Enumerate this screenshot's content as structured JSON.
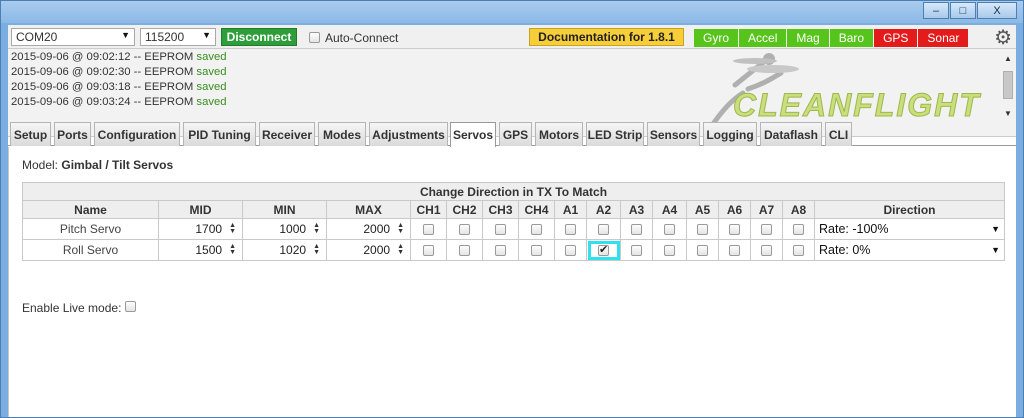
{
  "window": {
    "buttons": [
      "–",
      "□",
      "X"
    ]
  },
  "toolbar": {
    "port": "COM20",
    "baud": "115200",
    "disconnect_label": "Disconnect",
    "auto_connect_label": "Auto-Connect",
    "auto_connect_checked": false,
    "documentation_label": "Documentation for 1.8.1",
    "sensors": [
      {
        "label": "Gyro",
        "state": "on"
      },
      {
        "label": "Accel",
        "state": "on"
      },
      {
        "label": "Mag",
        "state": "on"
      },
      {
        "label": "Baro",
        "state": "on"
      },
      {
        "label": "GPS",
        "state": "off"
      },
      {
        "label": "Sonar",
        "state": "off"
      }
    ],
    "colors": {
      "sensor_on": "#57c41b",
      "sensor_off": "#e31b1b",
      "disconnect": "#2e9e3a",
      "documentation": "#f7ce39"
    },
    "settings_icon": "gear-icon"
  },
  "log": {
    "lines": [
      {
        "time": "2015-09-06 @ 09:02:12 -- EEPROM",
        "status": "saved"
      },
      {
        "time": "2015-09-06 @ 09:02:30 -- EEPROM",
        "status": "saved"
      },
      {
        "time": "2015-09-06 @ 09:03:18 -- EEPROM",
        "status": "saved"
      },
      {
        "time": "2015-09-06 @ 09:03:24 -- EEPROM",
        "status": "saved"
      }
    ],
    "logo_text": "CLEANFLIGHT"
  },
  "tabs": [
    "Setup",
    "Ports",
    "Configuration",
    "PID Tuning",
    "Receiver",
    "Modes",
    "Adjustments",
    "Servos",
    "GPS",
    "Motors",
    "LED Strip",
    "Sensors",
    "Logging",
    "Dataflash",
    "CLI"
  ],
  "active_tab": "Servos",
  "servos": {
    "model_label": "Model:",
    "model_value": "Gimbal / Tilt Servos",
    "caption": "Change Direction in TX To Match",
    "headers": [
      "Name",
      "MID",
      "MIN",
      "MAX",
      "CH1",
      "CH2",
      "CH3",
      "CH4",
      "A1",
      "A2",
      "A3",
      "A4",
      "A5",
      "A6",
      "A7",
      "A8",
      "Direction"
    ],
    "rows": [
      {
        "name": "Pitch Servo",
        "mid": "1700",
        "min": "1000",
        "max": "2000",
        "channels": [
          false,
          false,
          false,
          false,
          false,
          false,
          false,
          false,
          false,
          false,
          false,
          false
        ],
        "direction": "Rate: -100%"
      },
      {
        "name": "Roll Servo",
        "mid": "1500",
        "min": "1020",
        "max": "2000",
        "channels": [
          false,
          false,
          false,
          false,
          false,
          true,
          false,
          false,
          false,
          false,
          false,
          false
        ],
        "direction": "Rate: 0%"
      }
    ],
    "live_mode_label": "Enable Live mode:",
    "live_mode_checked": false
  }
}
